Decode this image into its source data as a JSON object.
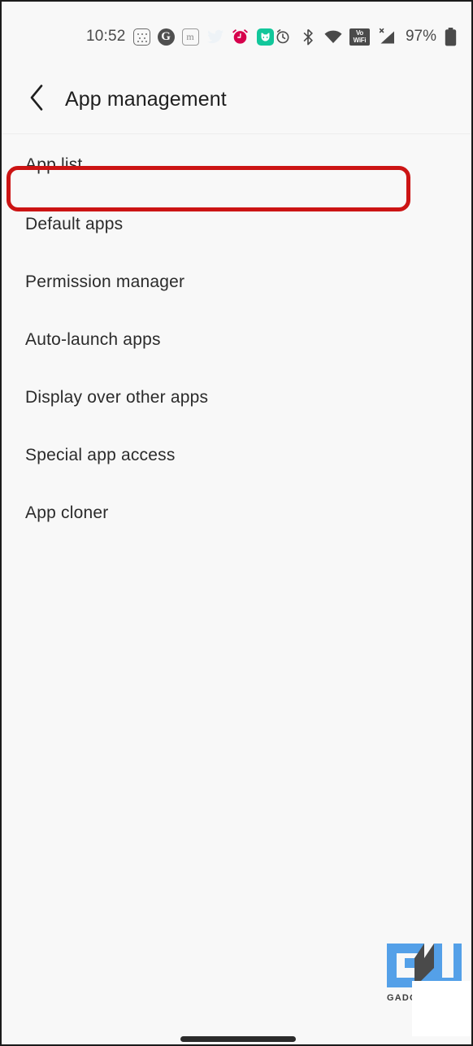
{
  "status_bar": {
    "clock": "10:52",
    "battery_percent": "97%",
    "notification_icons": [
      {
        "name": "dice-app-icon",
        "label": ""
      },
      {
        "name": "groww-app-icon",
        "label": "G"
      },
      {
        "name": "mastodon-app-icon",
        "label": "m"
      },
      {
        "name": "twitter-app-icon",
        "label": ""
      },
      {
        "name": "alarm-notification-icon",
        "label": ""
      },
      {
        "name": "mi-home-app-icon",
        "label": ""
      }
    ],
    "system_icons": [
      {
        "name": "alarm-set-icon",
        "label": ""
      },
      {
        "name": "bluetooth-icon",
        "label": ""
      },
      {
        "name": "wifi-icon",
        "label": ""
      },
      {
        "name": "vowifi-icon",
        "label_top": "Vo",
        "label_bottom": "WiFi"
      },
      {
        "name": "cellular-signal-icon",
        "label": "X"
      },
      {
        "name": "battery-icon",
        "label": ""
      }
    ],
    "colors": {
      "text": "#4a4a4a",
      "mi_home_green": "#12c79b",
      "alarm_red": "#d6004c"
    }
  },
  "header": {
    "title": "App management",
    "back_icon": "chevron-left-icon"
  },
  "settings": {
    "items": [
      {
        "label": "App list",
        "highlighted": true
      },
      {
        "label": "Default apps",
        "highlighted": false
      },
      {
        "label": "Permission manager",
        "highlighted": false
      },
      {
        "label": "Auto-launch apps",
        "highlighted": false
      },
      {
        "label": "Display over other apps",
        "highlighted": false
      },
      {
        "label": "Special app access",
        "highlighted": false
      },
      {
        "label": "App cloner",
        "highlighted": false
      }
    ],
    "highlight_color": "#cc1414"
  },
  "watermark": {
    "logo_text": "GU",
    "caption": "GADG",
    "blue": "#54a0e8",
    "gray": "#4a4a4a"
  },
  "navigation": {
    "gesture_bar": "home-gesture-bar"
  }
}
